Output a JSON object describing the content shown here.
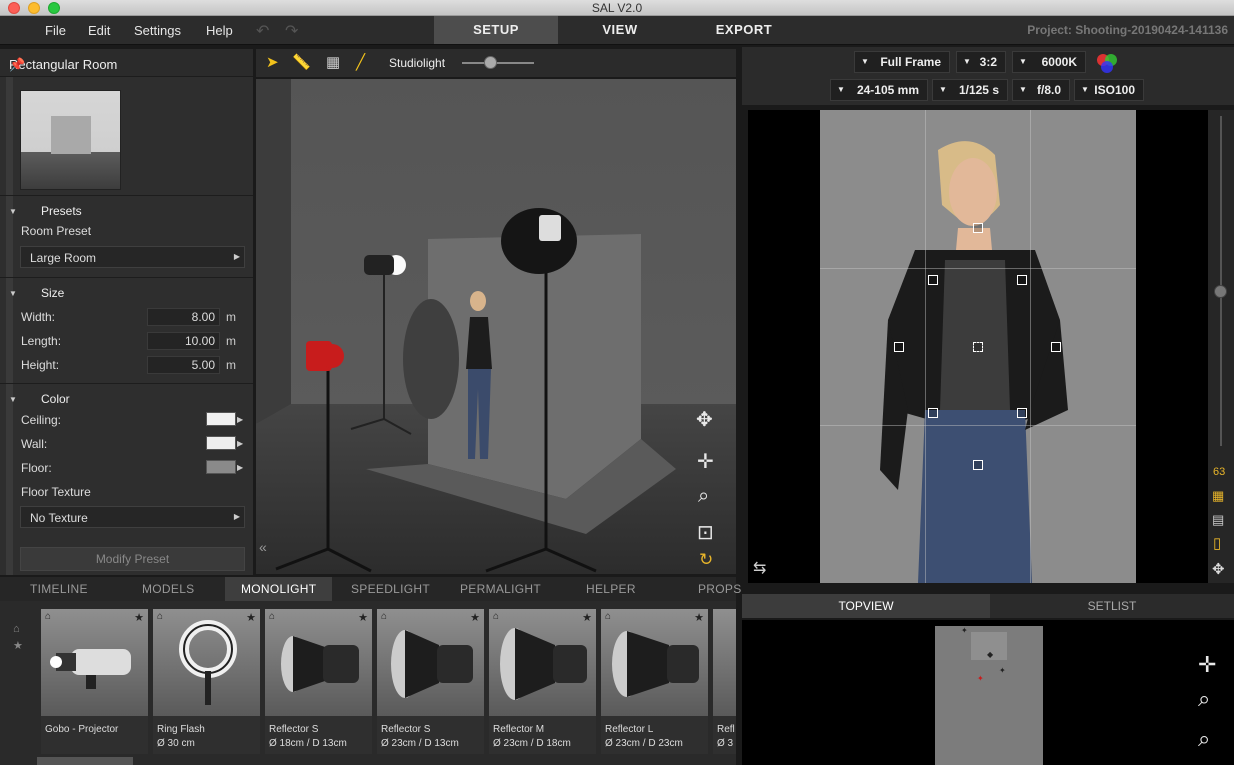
{
  "window": {
    "title": "SAL V2.0"
  },
  "menu": {
    "items": [
      "File",
      "Edit",
      "Settings",
      "Help"
    ]
  },
  "mode_tabs": [
    {
      "label": "SETUP",
      "active": true
    },
    {
      "label": "VIEW",
      "active": false
    },
    {
      "label": "EXPORT",
      "active": false
    }
  ],
  "project": "Project: Shooting-20190424-141136",
  "room_panel": {
    "title": "Rectangular Room",
    "presets": {
      "heading": "Presets",
      "label": "Room Preset",
      "value": "Large Room"
    },
    "size": {
      "heading": "Size",
      "width_label": "Width:",
      "width": "8.00",
      "length_label": "Length:",
      "length": "10.00",
      "height_label": "Height:",
      "height": "5.00",
      "unit": "m"
    },
    "color": {
      "heading": "Color",
      "ceiling_label": "Ceiling:",
      "wall_label": "Wall:",
      "floor_label": "Floor:",
      "ceiling": "#f0f0f0",
      "wall": "#eeeeee",
      "floor": "#8a8a8a",
      "texture_label": "Floor Texture",
      "texture_value": "No Texture"
    },
    "modify_button": "Modify Preset"
  },
  "viewport_toolbar": {
    "light_label": "Studiolight",
    "slider_level": 0.4
  },
  "bottom_tabs": [
    {
      "label": "TIMELINE",
      "active": false
    },
    {
      "label": "MODELS",
      "active": false
    },
    {
      "label": "MONOLIGHT",
      "active": true
    },
    {
      "label": "SPEEDLIGHT",
      "active": false
    },
    {
      "label": "PERMALIGHT",
      "active": false
    },
    {
      "label": "HELPER",
      "active": false
    },
    {
      "label": "PROPS",
      "active": false
    }
  ],
  "lights": [
    {
      "name": "Gobo - Projector",
      "sub": ""
    },
    {
      "name": "Ring Flash",
      "sub": "Ø 30 cm"
    },
    {
      "name": "Reflector S",
      "sub": "Ø 18cm / D 13cm"
    },
    {
      "name": "Reflector S",
      "sub": "Ø 23cm / D 13cm"
    },
    {
      "name": "Reflector M",
      "sub": "Ø 23cm / D 18cm"
    },
    {
      "name": "Reflector L",
      "sub": "Ø 23cm / D 23cm"
    },
    {
      "name": "Refl",
      "sub": "Ø 3"
    }
  ],
  "camera": {
    "frame": "Full Frame",
    "ratio": "3:2",
    "temperature": "6000K",
    "lens": "24-105 mm",
    "shutter": "1/125 s",
    "aperture": "f/8.0",
    "iso": "ISO100"
  },
  "zoom": {
    "value": "63",
    "level": 0.5
  },
  "topview_tabs": [
    {
      "label": "TOPVIEW",
      "active": true
    },
    {
      "label": "SETLIST",
      "active": false
    }
  ],
  "colors": {
    "accent_yellow": "#e8b52a",
    "selected_red": "#c81c1c"
  }
}
